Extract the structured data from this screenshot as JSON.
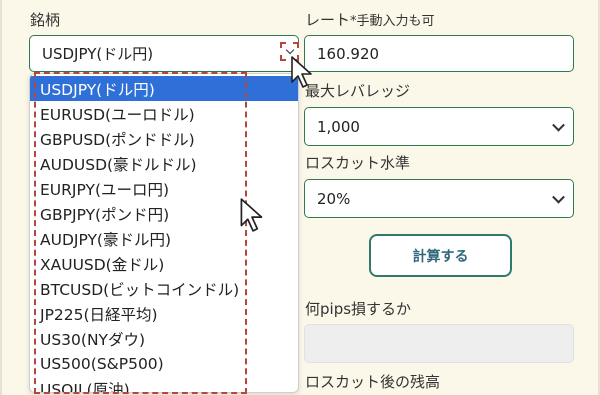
{
  "pair": {
    "label": "銘柄",
    "selected": "USDJPY(ドル円)",
    "options": [
      "USDJPY(ドル円)",
      "EURUSD(ユーロドル)",
      "GBPUSD(ポンドドル)",
      "AUDUSD(豪ドルドル)",
      "EURJPY(ユーロ円)",
      "GBPJPY(ポンド円)",
      "AUDJPY(豪ドル円)",
      "XAUUSD(金ドル)",
      "BTCUSD(ビットコインドル)",
      "JP225(日経平均)",
      "US30(NYダウ)",
      "US500(S&P500)",
      "USOIL(原油)"
    ],
    "highlighted_index": 0
  },
  "rate": {
    "label": "レート",
    "label_note": "*手動入力も可",
    "value": "160.920"
  },
  "leverage": {
    "label": "最大レバレッジ",
    "value": "1,000"
  },
  "losscut": {
    "label": "ロスカット水準",
    "value": "20%"
  },
  "calc_button": {
    "label": "計算する"
  },
  "pips": {
    "label": "何pips損するか",
    "value": ""
  },
  "remaining": {
    "label": "ロスカット後の残高"
  },
  "colors": {
    "accent": "#2f7a4f",
    "highlight": "#2f6fd8",
    "dash": "#b5473f",
    "background": "#fbf8e9"
  }
}
